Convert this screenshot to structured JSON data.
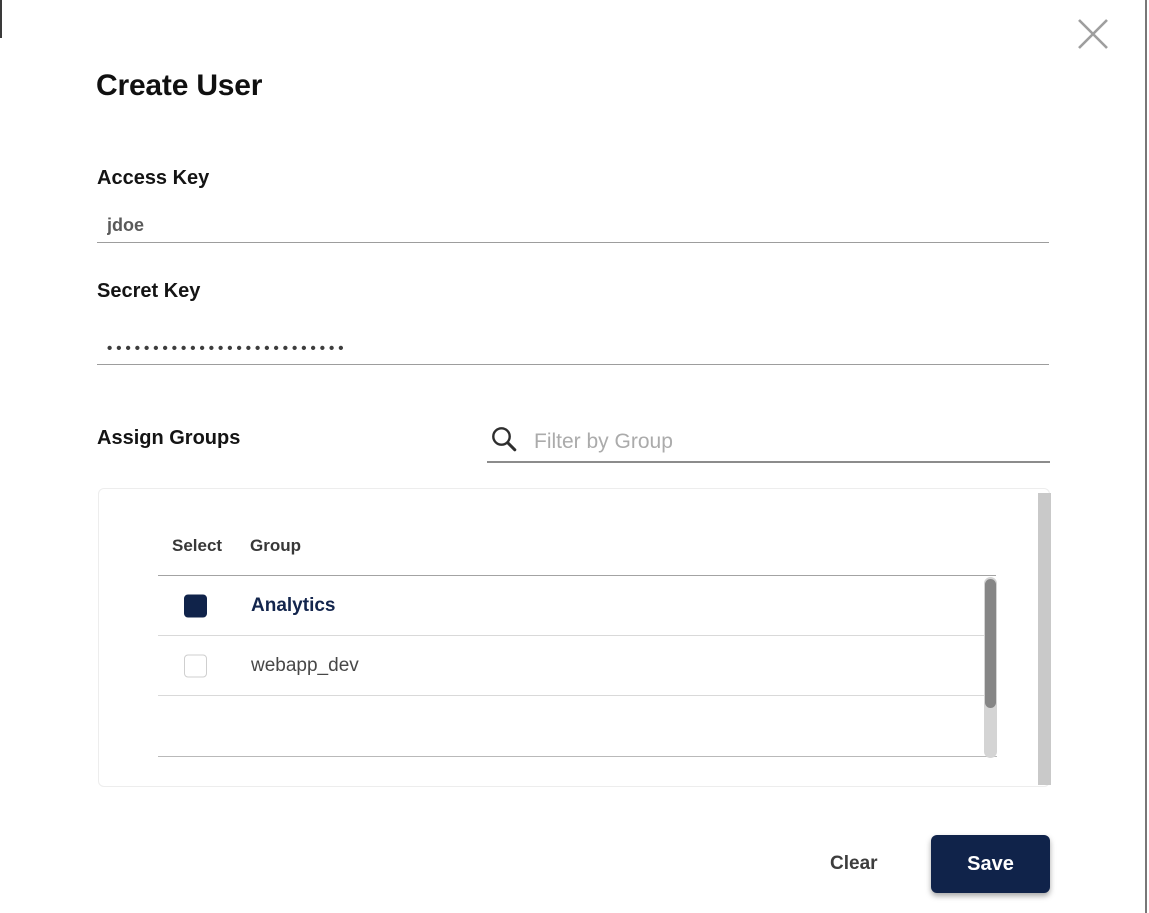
{
  "modal": {
    "title": "Create User"
  },
  "fields": {
    "access_key": {
      "label": "Access Key",
      "value": "jdoe"
    },
    "secret_key": {
      "label": "Secret Key",
      "masked_value": "••••••••••••••••••••••••••",
      "dot_count": 26
    }
  },
  "groups": {
    "label": "Assign Groups",
    "filter": {
      "placeholder": "Filter by Group",
      "value": "",
      "icon": "search-icon"
    },
    "table": {
      "columns": {
        "select": "Select",
        "group": "Group"
      },
      "rows": [
        {
          "group": "Analytics",
          "selected": true
        },
        {
          "group": "webapp_dev",
          "selected": false
        }
      ]
    }
  },
  "actions": {
    "clear": "Clear",
    "save": "Save"
  },
  "colors": {
    "navy": "#10234A",
    "underline": "#9D9D9D",
    "placeholder": "#ABABAB",
    "row_divider": "#D9D9D9",
    "scrollbar_thumb": "#868686",
    "scrollbar_track": "#D4D4D4",
    "panel_scrollbar": "#C9C9C9",
    "close_icon": "#9E9E9E"
  }
}
